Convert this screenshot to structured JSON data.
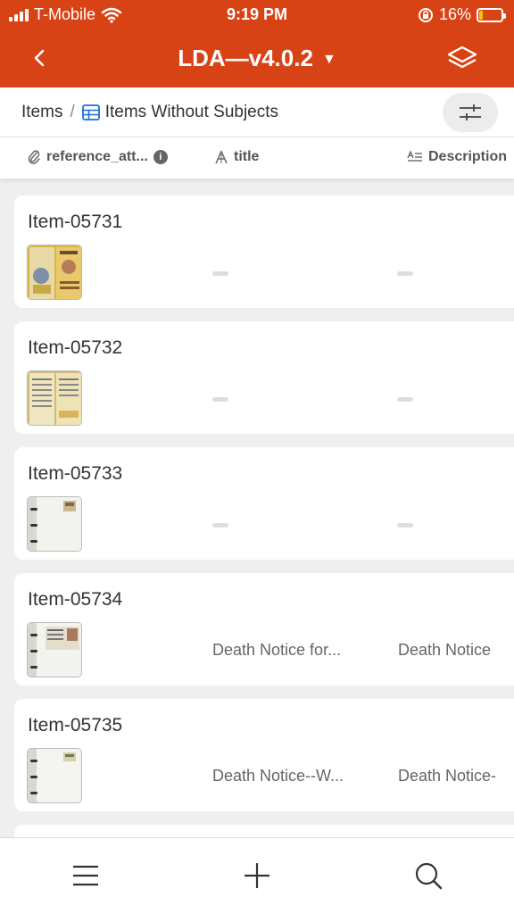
{
  "status_bar": {
    "carrier": "T-Mobile",
    "time": "9:19 PM",
    "battery": "16%",
    "battery_level": 0.16
  },
  "nav": {
    "title": "LDA—v4.0.2"
  },
  "breadcrumb": {
    "root": "Items",
    "separator": "/",
    "current": "Items Without Subjects"
  },
  "columns": {
    "reference": "reference_att...",
    "title": "title",
    "description": "Description"
  },
  "items": [
    {
      "name": "Item-05731",
      "title": "",
      "description": ""
    },
    {
      "name": "Item-05732",
      "title": "",
      "description": ""
    },
    {
      "name": "Item-05733",
      "title": "",
      "description": ""
    },
    {
      "name": "Item-05734",
      "title": "Death Notice for...",
      "description": "Death Notice"
    },
    {
      "name": "Item-05735",
      "title": "Death Notice--W...",
      "description": "Death Notice-"
    }
  ],
  "icons": {
    "back": "chevron-left-icon",
    "dropdown": "caret-down-icon",
    "layers": "layers-icon",
    "table": "table-grid-icon",
    "filter": "sliders-icon",
    "attachment": "paperclip-icon",
    "info": "info-icon",
    "text_field": "text-field-icon",
    "long_text": "long-text-icon",
    "menu": "hamburger-menu-icon",
    "add": "plus-icon",
    "search": "search-icon"
  },
  "colors": {
    "brand": "#d84315",
    "background": "#efefef",
    "accent_blue": "#1e6fd9"
  }
}
